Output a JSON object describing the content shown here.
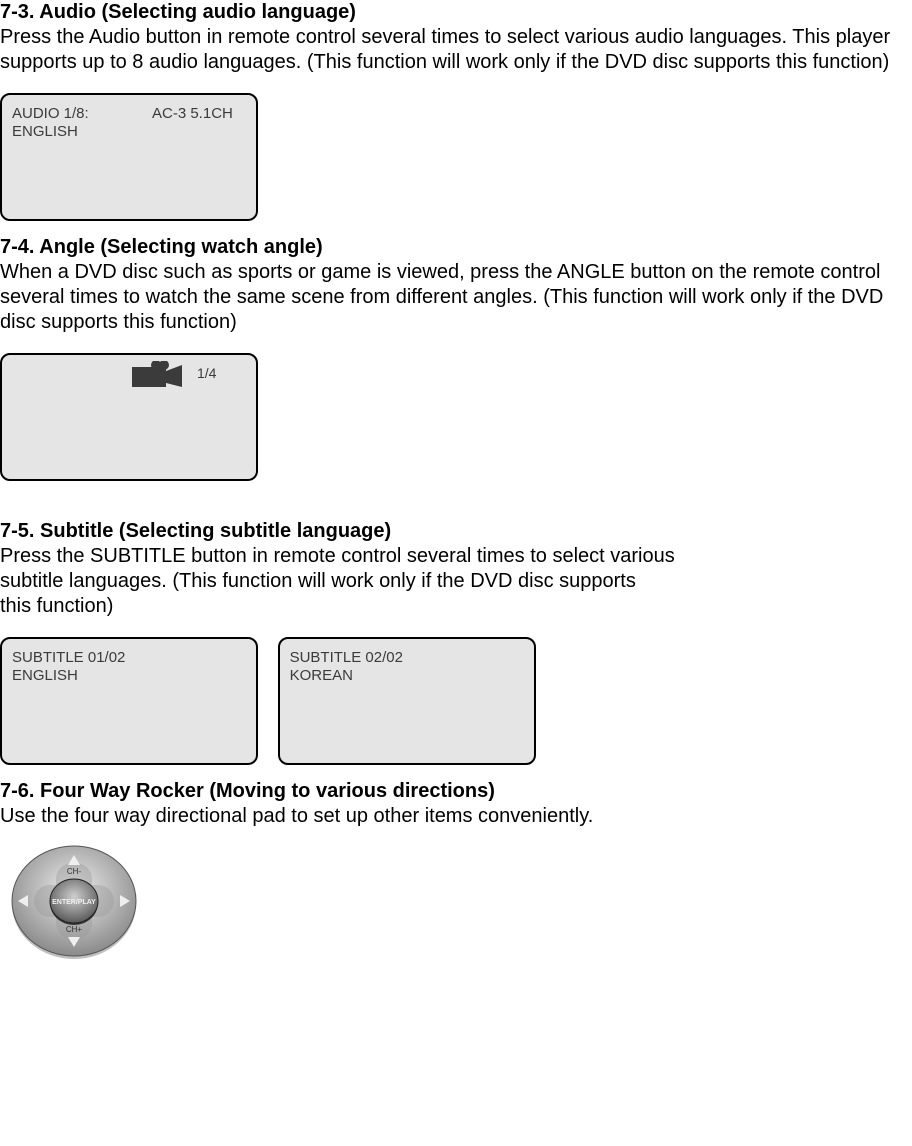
{
  "s73": {
    "heading": "7-3. Audio (Selecting audio language)",
    "para": "Press the Audio button in remote control several times to select various audio languages. This player supports up to 8 audio languages. (This function will work only if the DVD disc supports this function)",
    "screen": {
      "line1a": "AUDIO 1/8:",
      "line1b": "AC-3 5.1CH",
      "line2": "ENGLISH"
    }
  },
  "s74": {
    "heading": "7-4. Angle (Selecting watch angle)",
    "para": "When a DVD disc such as sports or game is viewed, press the ANGLE button on the remote control several times to watch the same scene from different angles. (This function will work only if the DVD disc supports this function)",
    "screen": {
      "label": "1/4"
    }
  },
  "s75": {
    "heading": "7-5. Subtitle (Selecting subtitle language)",
    "para1": "Press the SUBTITLE button in remote control several times to select various",
    "para2": "subtitle languages. (This function will work only if the DVD disc supports",
    "para3": "this function)",
    "screen1": {
      "line1": "SUBTITLE 01/02",
      "line2": "ENGLISH"
    },
    "screen2": {
      "line1": "SUBTITLE 02/02",
      "line2": "KOREAN"
    }
  },
  "s76": {
    "heading": "7-6. Four Way Rocker (Moving to various directions)",
    "para": "Use the four way directional pad to set up other items conveniently.",
    "rocker": {
      "center": "ENTER/PLAY",
      "top": "CH-",
      "bottom": "CH+"
    }
  }
}
